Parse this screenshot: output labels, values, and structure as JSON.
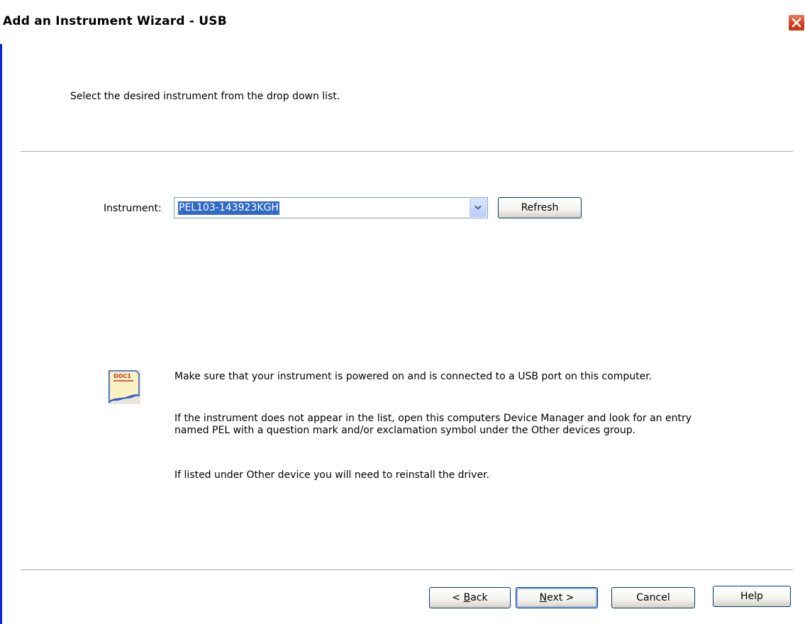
{
  "window": {
    "title": "Add an Instrument Wizard - USB",
    "close_icon": "close-icon"
  },
  "header": {
    "instruction": "Select the desired instrument from the drop down list."
  },
  "instrument": {
    "label": "Instrument:",
    "selected_value": "PEL103-143923KGH",
    "refresh_label": "Refresh"
  },
  "info": {
    "icon": "document-icon",
    "icon_text": "DOC1",
    "line1": "Make sure that your instrument is powered on and is connected to a USB port on this computer.",
    "line2a": "If the instrument does not appear in the list, open this computers Device Manager and look for an entry",
    "line2b": "named PEL with a question mark and/or exclamation symbol under the Other devices group.",
    "line3": "If listed under Other device you will need to reinstall the driver."
  },
  "footer": {
    "back_prefix": "< ",
    "back_mnemonic": "B",
    "back_rest": "ack",
    "next_mnemonic": "N",
    "next_rest": "ext >",
    "cancel_label": "Cancel",
    "help_label": "Help"
  },
  "colors": {
    "selection": "#316ac5",
    "close_button": "#d44222",
    "window_edge": "#0a2bd2"
  }
}
